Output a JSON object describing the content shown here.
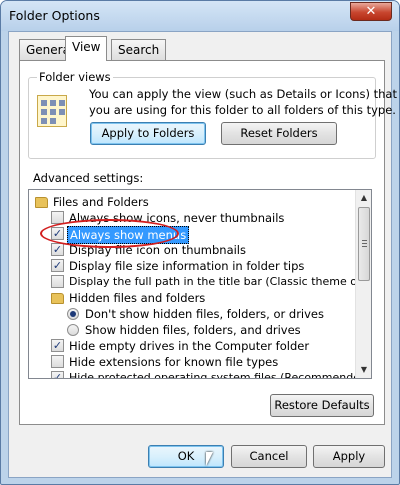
{
  "window": {
    "title": "Folder Options",
    "close_label": "✕"
  },
  "tabs": [
    {
      "label": "General"
    },
    {
      "label": "View"
    },
    {
      "label": "Search"
    }
  ],
  "folder_views": {
    "label": "Folder views",
    "description_line1": "You can apply the view (such as Details or Icons) that",
    "description_line2": "you are using for this folder to all folders of this type.",
    "apply_button": "Apply to Folders",
    "reset_button": "Reset Folders"
  },
  "advanced": {
    "label": "Advanced settings:",
    "items": [
      {
        "type": "folder",
        "label": "Files and Folders"
      },
      {
        "type": "checkbox",
        "checked": false,
        "label": "Always show icons, never thumbnails"
      },
      {
        "type": "checkbox",
        "checked": true,
        "label": "Always show menus",
        "selected": true
      },
      {
        "type": "checkbox",
        "checked": true,
        "label": "Display file icon on thumbnails"
      },
      {
        "type": "checkbox",
        "checked": true,
        "label": "Display file size information in folder tips"
      },
      {
        "type": "checkbox",
        "checked": false,
        "label": "Display the full path in the title bar (Classic theme only)"
      },
      {
        "type": "folder",
        "label": "Hidden files and folders"
      },
      {
        "type": "radio",
        "checked": true,
        "label": "Don't show hidden files, folders, or drives"
      },
      {
        "type": "radio",
        "checked": false,
        "label": "Show hidden files, folders, and drives"
      },
      {
        "type": "checkbox",
        "checked": true,
        "label": "Hide empty drives in the Computer folder"
      },
      {
        "type": "checkbox",
        "checked": false,
        "label": "Hide extensions for known file types"
      },
      {
        "type": "checkbox",
        "checked": true,
        "label": "Hide protected operating system files (Recommended)"
      }
    ],
    "check_mark": "✓"
  },
  "restore_button": "Restore Defaults",
  "footer": {
    "ok": "OK",
    "cancel": "Cancel",
    "apply": "Apply"
  },
  "scroll": {
    "up": "▲",
    "down": "▼"
  },
  "colors": {
    "selection": "#3399ff",
    "highlight_circle": "#d21f1f"
  }
}
